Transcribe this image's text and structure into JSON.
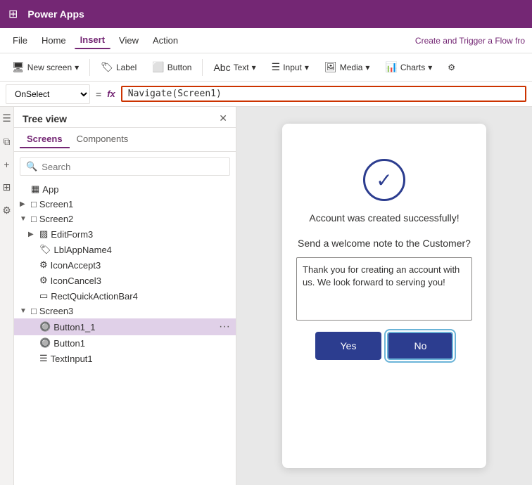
{
  "titleBar": {
    "title": "Power Apps",
    "appIcon": "⊞"
  },
  "menuBar": {
    "items": [
      "File",
      "Home",
      "Insert",
      "View",
      "Action"
    ],
    "activeItem": "Insert",
    "rightText": "Create and Trigger a Flow fro"
  },
  "toolbar": {
    "buttons": [
      {
        "id": "new-screen",
        "icon": "🖥",
        "label": "New screen",
        "hasDropdown": true
      },
      {
        "id": "label",
        "icon": "🏷",
        "label": "Label",
        "hasDropdown": false
      },
      {
        "id": "button",
        "icon": "🔘",
        "label": "Button",
        "hasDropdown": false
      },
      {
        "id": "text",
        "icon": "T",
        "label": "Text",
        "hasDropdown": true
      },
      {
        "id": "input",
        "icon": "☰",
        "label": "Input",
        "hasDropdown": true
      },
      {
        "id": "media",
        "icon": "🖼",
        "label": "Media",
        "hasDropdown": true
      },
      {
        "id": "charts",
        "icon": "📊",
        "label": "Charts",
        "hasDropdown": true
      },
      {
        "id": "icons-btn",
        "icon": "⚙",
        "label": "",
        "hasDropdown": false
      }
    ]
  },
  "formulaBar": {
    "selector": "OnSelect",
    "equals": "=",
    "fx": "fx",
    "formula": "Navigate(Screen1)"
  },
  "treeView": {
    "title": "Tree view",
    "tabs": [
      "Screens",
      "Components"
    ],
    "activeTab": "Screens",
    "searchPlaceholder": "Search",
    "items": [
      {
        "id": "app",
        "label": "App",
        "indent": 0,
        "icon": "▦",
        "chevron": ""
      },
      {
        "id": "screen1",
        "label": "Screen1",
        "indent": 0,
        "icon": "□",
        "chevron": "▶",
        "expanded": false
      },
      {
        "id": "screen2",
        "label": "Screen2",
        "indent": 0,
        "icon": "□",
        "chevron": "▼",
        "expanded": true
      },
      {
        "id": "editform3",
        "label": "EditForm3",
        "indent": 1,
        "icon": "▨",
        "chevron": "▶"
      },
      {
        "id": "lblappname4",
        "label": "LblAppName4",
        "indent": 1,
        "icon": "🏷",
        "chevron": ""
      },
      {
        "id": "iconaccept3",
        "label": "IconAccept3",
        "indent": 1,
        "icon": "⚙",
        "chevron": ""
      },
      {
        "id": "iconcancel3",
        "label": "IconCancel3",
        "indent": 1,
        "icon": "⚙",
        "chevron": ""
      },
      {
        "id": "rectquickactionbar4",
        "label": "RectQuickActionBar4",
        "indent": 1,
        "icon": "▭",
        "chevron": ""
      },
      {
        "id": "screen3",
        "label": "Screen3",
        "indent": 0,
        "icon": "□",
        "chevron": "▼",
        "expanded": true
      },
      {
        "id": "button1_1",
        "label": "Button1_1",
        "indent": 1,
        "icon": "🔘",
        "chevron": "",
        "active": true
      },
      {
        "id": "button1",
        "label": "Button1",
        "indent": 1,
        "icon": "🔘",
        "chevron": ""
      },
      {
        "id": "textinput1",
        "label": "TextInput1",
        "indent": 1,
        "icon": "☰",
        "chevron": ""
      }
    ]
  },
  "canvas": {
    "successIcon": "✓",
    "successText": "Account was created successfully!",
    "welcomeLabel": "Send a welcome note to the Customer?",
    "welcomeMessage": "Thank you for creating an account with us. We look forward to serving you!",
    "yesLabel": "Yes",
    "noLabel": "No"
  }
}
